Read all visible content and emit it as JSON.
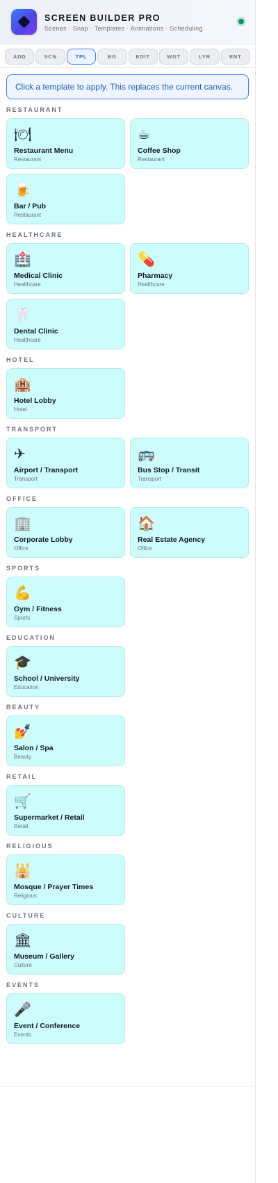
{
  "app": {
    "title": "SCREEN BUILDER PRO",
    "subtitle": "Scenes · Snap · Templates · Animations · Scheduling",
    "status_color": "#059669"
  },
  "tabs": [
    {
      "label": "ADD",
      "active": false
    },
    {
      "label": "SCN",
      "active": false
    },
    {
      "label": "TPL",
      "active": true
    },
    {
      "label": "BG",
      "active": false
    },
    {
      "label": "EDIT",
      "active": false
    },
    {
      "label": "WGT",
      "active": false
    },
    {
      "label": "LYR",
      "active": false
    },
    {
      "label": "ENT",
      "active": false
    }
  ],
  "info": "Click a template to apply. This replaces the current canvas.",
  "accent_color": "#3b82f6",
  "card_color": "#ccfcfc",
  "sections": [
    {
      "id": "restaurant",
      "title": "RESTAURANT",
      "templates": [
        {
          "name": "Restaurant Menu",
          "category": "Restaurant",
          "icon": "🍽",
          "icon_name": "plate-cutlery-icon"
        },
        {
          "name": "Coffee Shop",
          "category": "Restaurant",
          "icon": "☕",
          "icon_name": "coffee-icon"
        },
        {
          "name": "Bar / Pub",
          "category": "Restaurant",
          "icon": "🍺",
          "icon_name": "beer-icon"
        }
      ]
    },
    {
      "id": "healthcare",
      "title": "HEALTHCARE",
      "templates": [
        {
          "name": "Medical Clinic",
          "category": "Healthcare",
          "icon": "🏥",
          "icon_name": "hospital-icon"
        },
        {
          "name": "Pharmacy",
          "category": "Healthcare",
          "icon": "💊",
          "icon_name": "pill-icon"
        },
        {
          "name": "Dental Clinic",
          "category": "Healthcare",
          "icon": "🦷",
          "icon_name": "tooth-icon"
        }
      ]
    },
    {
      "id": "hotel",
      "title": "HOTEL",
      "templates": [
        {
          "name": "Hotel Lobby",
          "category": "Hotel",
          "icon": "🏨",
          "icon_name": "hotel-icon"
        }
      ]
    },
    {
      "id": "transport",
      "title": "TRANSPORT",
      "templates": [
        {
          "name": "Airport / Transport",
          "category": "Transport",
          "icon": "✈",
          "icon_name": "airplane-icon"
        },
        {
          "name": "Bus Stop / Transit",
          "category": "Transport",
          "icon": "🚌",
          "icon_name": "bus-icon"
        }
      ]
    },
    {
      "id": "office",
      "title": "OFFICE",
      "templates": [
        {
          "name": "Corporate Lobby",
          "category": "Office",
          "icon": "🏢",
          "icon_name": "office-building-icon"
        },
        {
          "name": "Real Estate Agency",
          "category": "Office",
          "icon": "🏠",
          "icon_name": "house-icon"
        }
      ]
    },
    {
      "id": "sports",
      "title": "SPORTS",
      "templates": [
        {
          "name": "Gym / Fitness",
          "category": "Sports",
          "icon": "💪",
          "icon_name": "flexed-arm-icon"
        }
      ]
    },
    {
      "id": "education",
      "title": "EDUCATION",
      "templates": [
        {
          "name": "School / University",
          "category": "Education",
          "icon": "🎓",
          "icon_name": "graduation-cap-icon"
        }
      ]
    },
    {
      "id": "beauty",
      "title": "BEAUTY",
      "templates": [
        {
          "name": "Salon / Spa",
          "category": "Beauty",
          "icon": "💅",
          "icon_name": "nail-polish-icon"
        }
      ]
    },
    {
      "id": "retail",
      "title": "RETAIL",
      "templates": [
        {
          "name": "Supermarket / Retail",
          "category": "Retail",
          "icon": "🛒",
          "icon_name": "shopping-cart-icon"
        }
      ]
    },
    {
      "id": "religious",
      "title": "RELIGIOUS",
      "templates": [
        {
          "name": "Mosque / Prayer Times",
          "category": "Religious",
          "icon": "🕌",
          "icon_name": "mosque-icon"
        }
      ]
    },
    {
      "id": "culture",
      "title": "CULTURE",
      "templates": [
        {
          "name": "Museum / Gallery",
          "category": "Culture",
          "icon": "🏛",
          "icon_name": "museum-icon"
        }
      ]
    },
    {
      "id": "events",
      "title": "EVENTS",
      "templates": [
        {
          "name": "Event / Conference",
          "category": "Events",
          "icon": "🎤",
          "icon_name": "microphone-icon"
        }
      ]
    }
  ]
}
